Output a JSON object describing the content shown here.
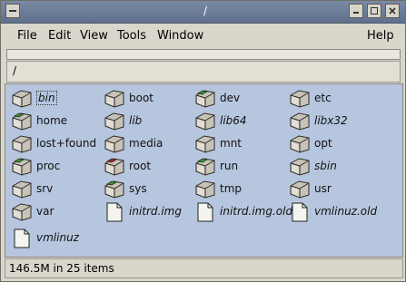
{
  "window": {
    "title": "/"
  },
  "titlebar_buttons": [
    "window-menu-icon",
    "minimize-icon",
    "maximize-icon",
    "close-icon"
  ],
  "menu": {
    "file": "File",
    "edit": "Edit",
    "view": "View",
    "tools": "Tools",
    "window": "Window",
    "help": "Help"
  },
  "location": {
    "path": "/"
  },
  "items": [
    {
      "name": "bin",
      "type": "folder",
      "italic": true,
      "selected": true
    },
    {
      "name": "boot",
      "type": "folder"
    },
    {
      "name": "dev",
      "type": "folder-green"
    },
    {
      "name": "etc",
      "type": "folder"
    },
    {
      "name": "home",
      "type": "folder-green"
    },
    {
      "name": "lib",
      "type": "folder",
      "italic": true
    },
    {
      "name": "lib64",
      "type": "folder",
      "italic": true
    },
    {
      "name": "libx32",
      "type": "folder",
      "italic": true
    },
    {
      "name": "lost+found",
      "type": "folder"
    },
    {
      "name": "media",
      "type": "folder"
    },
    {
      "name": "mnt",
      "type": "folder"
    },
    {
      "name": "opt",
      "type": "folder"
    },
    {
      "name": "proc",
      "type": "folder-green"
    },
    {
      "name": "root",
      "type": "folder-red"
    },
    {
      "name": "run",
      "type": "folder-green"
    },
    {
      "name": "sbin",
      "type": "folder",
      "italic": true
    },
    {
      "name": "srv",
      "type": "folder"
    },
    {
      "name": "sys",
      "type": "folder-green"
    },
    {
      "name": "tmp",
      "type": "folder"
    },
    {
      "name": "usr",
      "type": "folder"
    },
    {
      "name": "var",
      "type": "folder"
    },
    {
      "name": "initrd.img",
      "type": "file",
      "italic": true
    },
    {
      "name": "initrd.img.old",
      "type": "file",
      "italic": true
    },
    {
      "name": "vmlinuz.old",
      "type": "file",
      "italic": true
    },
    {
      "name": "vmlinuz",
      "type": "file",
      "italic": true
    }
  ],
  "status": {
    "text": "146.5M in 25 items"
  },
  "colors": {
    "folder_fill": "#c8c3b8",
    "folder_stroke": "#2d2b27",
    "accent_green": "#2e9a2e",
    "accent_red": "#b02222",
    "file_area": "#b7c6df"
  }
}
